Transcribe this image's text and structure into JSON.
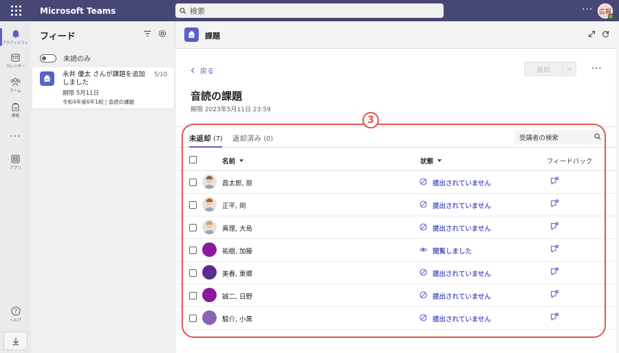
{
  "app": {
    "title": "Microsoft Teams",
    "search_placeholder": "検索",
    "user_initials": "広報"
  },
  "rail": {
    "items": [
      {
        "label": "アクティビティ",
        "icon": "bell-icon",
        "active": true
      },
      {
        "label": "カレンダー",
        "icon": "calendar-icon"
      },
      {
        "label": "チーム",
        "icon": "teams-icon"
      },
      {
        "label": "課題",
        "icon": "assignments-icon"
      },
      {
        "label": "アプリ",
        "icon": "apps-icon"
      },
      {
        "label": "ヘルプ",
        "icon": "help-icon"
      }
    ]
  },
  "feed": {
    "title": "フィード",
    "unread_only": "未読のみ",
    "card": {
      "headline": "永井 優太 さんが課題を追加しました",
      "date": "5/10",
      "deadline": "期限 5月11日",
      "class_line": "令和4年度6年1組 | 音読の課題"
    }
  },
  "main": {
    "header_title": "課題",
    "back_label": "戻る",
    "return_label": "返却",
    "assignment_title": "音読の課題",
    "deadline": "期限 2023年5月11日 23:59",
    "callout": "3",
    "tabs": [
      {
        "label": "未返却",
        "count": "(7)"
      },
      {
        "label": "返却済み",
        "count": "(0)"
      }
    ],
    "roster_search_placeholder": "受講者の検索",
    "columns": {
      "name": "名前",
      "status": "状態",
      "feedback": "フィードバック"
    },
    "students": [
      {
        "name": "昌太郎, 原",
        "status": "提出されていません",
        "status_type": "not-submitted",
        "avatar": "photo",
        "avatar_color": "#7a6a5a"
      },
      {
        "name": "正平, 岡",
        "status": "提出されていません",
        "status_type": "not-submitted",
        "avatar": "photo",
        "avatar_color": "#c94b3c"
      },
      {
        "name": "真理, 大島",
        "status": "提出されていません",
        "status_type": "not-submitted",
        "avatar": "photo",
        "avatar_color": "#c9a36a"
      },
      {
        "name": "祐樹, 加藤",
        "status": "閲覧しました",
        "status_type": "viewed",
        "avatar": "solid",
        "avatar_color": "#8b1a9c"
      },
      {
        "name": "美春, 東郷",
        "status": "提出されていません",
        "status_type": "not-submitted",
        "avatar": "solid",
        "avatar_color": "#5c2d91"
      },
      {
        "name": "誠二, 日野",
        "status": "提出されていません",
        "status_type": "not-submitted",
        "avatar": "solid",
        "avatar_color": "#8b1a9c"
      },
      {
        "name": "駿介, 小黒",
        "status": "提出されていません",
        "status_type": "not-submitted",
        "avatar": "solid",
        "avatar_color": "#8764b8"
      }
    ]
  },
  "colors": {
    "topbar": "#464775",
    "accent": "#5b5fc7",
    "annotation": "#e0534a"
  }
}
